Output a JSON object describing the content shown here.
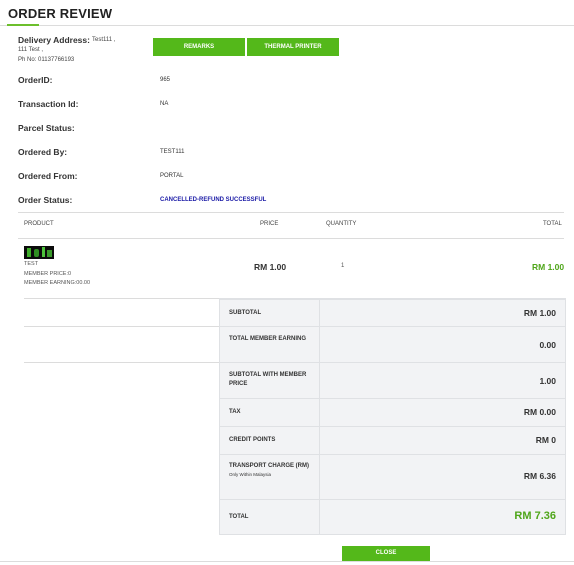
{
  "header": {
    "title": "ORDER REVIEW"
  },
  "delivery": {
    "label": "Delivery Address:",
    "line1": "Test111 ,",
    "line2": "111 Test ,",
    "phone": "Ph No: 01137766193"
  },
  "buttons": {
    "remarks": "REMARKS",
    "thermal_printer": "THERMAL PRINTER",
    "close": "CLOSE"
  },
  "info": {
    "order_id_label": "OrderID:",
    "order_id": "965",
    "transaction_label": "Transaction Id:",
    "transaction": "NA",
    "parcel_label": "Parcel Status:",
    "parcel": "",
    "ordered_by_label": "Ordered By:",
    "ordered_by": "TEST111",
    "ordered_from_label": "Ordered From:",
    "ordered_from": "PORTAL",
    "status_label": "Order Status:",
    "status": "CANCELLED-REFUND SUCCESSFUL"
  },
  "table": {
    "headers": {
      "product": "PRODUCT",
      "price": "PRICE",
      "quantity": "QUANTITY",
      "total": "TOTAL"
    },
    "rows": [
      {
        "name": "TEST",
        "member_price": "MEMBER PRICE:0",
        "member_earning": "MEMBER EARNING:00.00",
        "price": "RM 1.00",
        "quantity": "1",
        "total": "RM 1.00"
      }
    ]
  },
  "summary": {
    "subtotal_label": "SUBTOTAL",
    "subtotal": "RM 1.00",
    "member_earning_label": "TOTAL MEMBER EARNING",
    "member_earning": "0.00",
    "subtotal_member_label": "SUBTOTAL WITH MEMBER PRICE",
    "subtotal_member": "1.00",
    "tax_label": "TAX",
    "tax": "RM 0.00",
    "credit_label": "CREDIT POINTS",
    "credit": "RM 0",
    "transport_label": "TRANSPORT CHARGE (RM)",
    "transport_note": "Only Within Malaysia",
    "transport": "RM 6.36",
    "total_label": "TOTAL",
    "total": "RM 7.36"
  },
  "colors": {
    "accent_green": "#54b81a",
    "status_blue": "#1a1aa6",
    "total_green": "#4fa61a"
  }
}
